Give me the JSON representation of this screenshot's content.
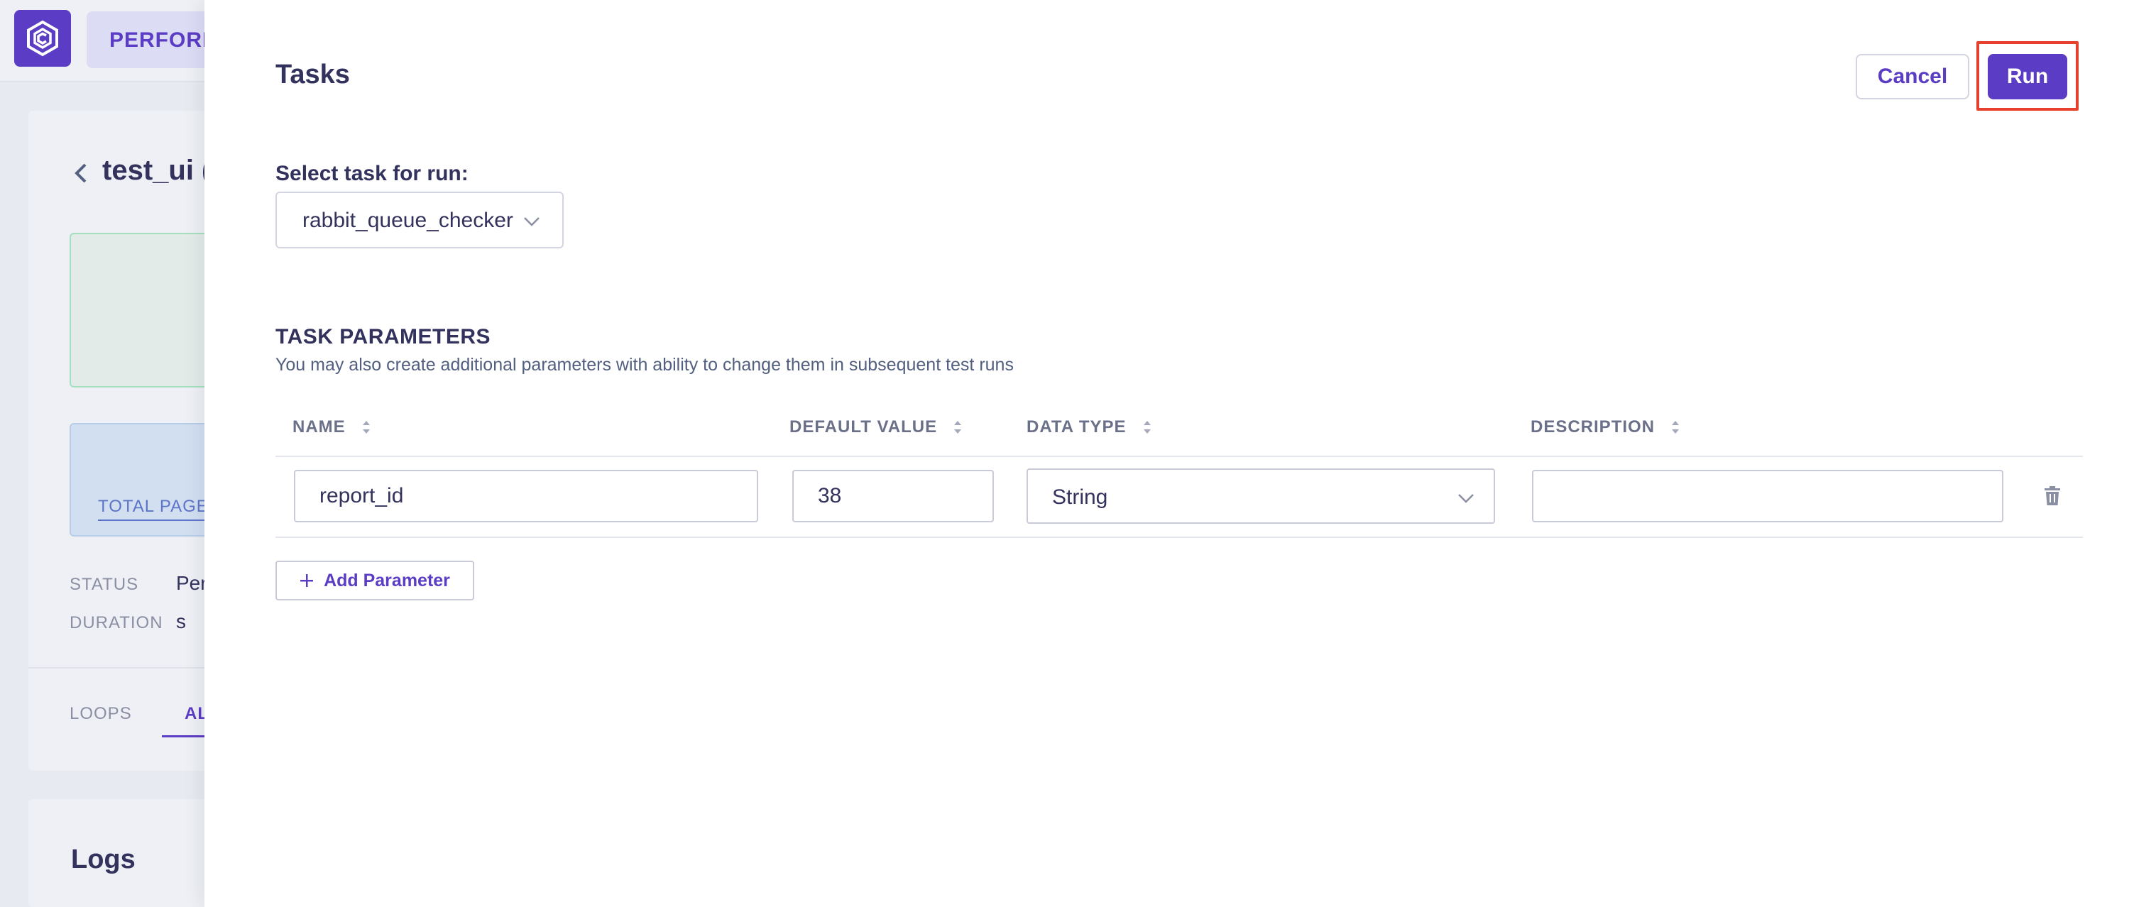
{
  "background": {
    "nav_tab_label": "PERFORM",
    "page_title": "test_ui (",
    "total_pages_label": "TOTAL PAGES",
    "status_label": "STATUS",
    "status_value": "Per",
    "duration_label": "DURATION",
    "duration_value": "s",
    "tabs": [
      {
        "label": "LOOPS"
      },
      {
        "label": "AL"
      }
    ],
    "logs_title": "Logs"
  },
  "modal": {
    "title": "Tasks",
    "cancel_label": "Cancel",
    "run_label": "Run",
    "select_task_label": "Select task for run:",
    "selected_task": "rabbit_queue_checker",
    "params_title": "TASK PARAMETERS",
    "params_description": "You may also create additional parameters with ability to change them in subsequent test runs",
    "table": {
      "columns": [
        "NAME",
        "DEFAULT VALUE",
        "DATA TYPE",
        "DESCRIPTION"
      ],
      "rows": [
        {
          "name": "report_id",
          "default_value": "38",
          "data_type": "String",
          "description": ""
        }
      ]
    },
    "add_parameter_label": "Add Parameter"
  },
  "colors": {
    "accent": "#5b3cc4",
    "highlight": "#e8402e",
    "text_primary": "#32325d"
  }
}
